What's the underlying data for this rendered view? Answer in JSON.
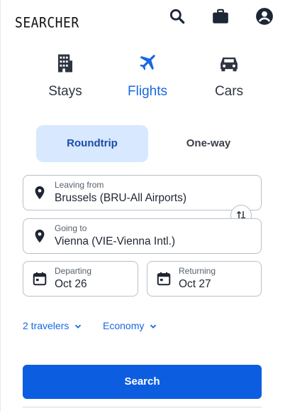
{
  "header": {
    "logo_text": "SEARCHER",
    "icons": [
      "search-icon",
      "briefcase-icon",
      "account-icon"
    ]
  },
  "categories": [
    {
      "label": "Stays",
      "icon": "hotel-building-icon",
      "active": false
    },
    {
      "label": "Flights",
      "icon": "airplane-icon",
      "active": true
    },
    {
      "label": "Cars",
      "icon": "car-icon",
      "active": false
    }
  ],
  "trip_type": {
    "roundtrip_label": "Roundtrip",
    "oneway_label": "One-way",
    "selected": "Roundtrip"
  },
  "form": {
    "leaving": {
      "label": "Leaving from",
      "value": "Brussels (BRU-All Airports)",
      "icon": "location-pin-icon"
    },
    "going": {
      "label": "Going to",
      "value": "Vienna (VIE-Vienna Intl.)",
      "icon": "location-pin-icon"
    },
    "swap_icon": "swap-arrows-icon",
    "departing": {
      "label": "Departing",
      "value": "Oct 26",
      "icon": "calendar-icon"
    },
    "returning": {
      "label": "Returning",
      "value": "Oct 27",
      "icon": "calendar-icon"
    }
  },
  "options": {
    "travelers": "2 travelers",
    "cabin": "Economy"
  },
  "search_button": "Search",
  "colors": {
    "accent": "#1668e3",
    "button": "#0d5de0",
    "tab_active_bg": "#d7e8ff",
    "text": "#1f2532",
    "border": "#b9bfc9"
  }
}
